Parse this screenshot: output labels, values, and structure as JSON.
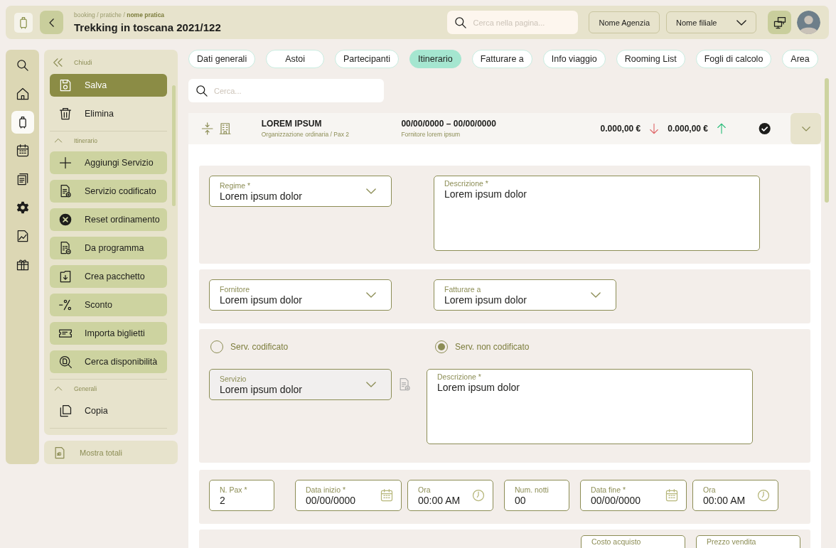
{
  "header": {
    "breadcrumb": "booking / pratiche / **nome pratica**",
    "title": "Trekking in toscana 2021/122",
    "search": {
      "placeholder": "Cerca nella pagina..."
    },
    "agency": "Nome Agenzia",
    "branch": "Nome filiale"
  },
  "rail": [
    {
      "selected": false
    },
    {
      "selected": false
    },
    {
      "selected": true
    },
    {
      "selected": false
    },
    {
      "selected": false
    },
    {
      "selected": false
    },
    {
      "selected": false
    },
    {
      "selected": false
    }
  ],
  "sidebar": {
    "close": "Chiudi",
    "groups": [
      {
        "items": [
          {
            "label": "Salva",
            "kind": "primary"
          },
          {
            "label": "Elimina",
            "kind": "plain"
          }
        ]
      },
      {
        "title": "Itinerario",
        "expanded": true,
        "items": [
          {
            "label": "Aggiungi Servizio",
            "kind": "action"
          },
          {
            "label": "Servizio codificato",
            "kind": "action"
          },
          {
            "label": "Reset ordinamento",
            "kind": "action"
          },
          {
            "label": "Da programma",
            "kind": "action"
          },
          {
            "label": "Crea pacchetto",
            "kind": "action"
          },
          {
            "label": "Sconto",
            "kind": "action"
          },
          {
            "label": "Importa biglietti",
            "kind": "action"
          },
          {
            "label": "Cerca disponibilità",
            "kind": "action"
          }
        ]
      },
      {
        "title": "Generali",
        "expanded": true,
        "items": [
          {
            "label": "Copia",
            "kind": "plain"
          }
        ]
      }
    ],
    "totals": "Mostra totali"
  },
  "tabs": [
    {
      "label": "Dati generali",
      "selected": false
    },
    {
      "label": "Astoi",
      "selected": false
    },
    {
      "label": "Partecipanti",
      "selected": false
    },
    {
      "label": "Itinerario",
      "selected": true
    },
    {
      "label": "Fatturare a",
      "selected": false
    },
    {
      "label": "Info viaggio",
      "selected": false
    },
    {
      "label": "Rooming List",
      "selected": false
    },
    {
      "label": "Fogli  di calcolo",
      "selected": false
    },
    {
      "label": "Area",
      "selected": false
    }
  ],
  "search": {
    "placeholder": "Cerca..."
  },
  "service": {
    "title": "LOREM IPSUM",
    "subtitle": "Organizzazione ordinaria / Pax 2",
    "dates": "00/00/0000 – 00/00/0000",
    "supplier": "Fornitore lorem ipsum",
    "cost": "0.000,00 €",
    "price": "0.000,00 €",
    "confirmed": true,
    "expanded": true
  },
  "sections": [
    {
      "fields": [
        {
          "kind": "select",
          "label": "Regime *",
          "value": "Lorem ipsum dolor"
        },
        {
          "kind": "textarea",
          "label": "Descrizione *",
          "value": "Lorem ipsum dolor"
        }
      ]
    },
    {
      "fields": [
        {
          "kind": "select",
          "label": "Fornitore",
          "value": "Lorem ipsum dolor"
        },
        {
          "kind": "select",
          "label": "Fatturare a",
          "value": "Lorem ipsum dolor"
        }
      ]
    },
    {
      "radios": [
        {
          "label": "Serv. codificato",
          "selected": false
        },
        {
          "label": "Serv. non codificato",
          "selected": true
        }
      ],
      "fields": [
        {
          "kind": "select",
          "label": "Servizio",
          "value": "Lorem ipsum dolor",
          "disabled": true
        },
        {
          "kind": "textarea",
          "label": "Descrizione *",
          "value": "Lorem ipsum dolor"
        }
      ]
    },
    {
      "fields": [
        {
          "kind": "text",
          "label": "N. Pax *",
          "value": "2"
        },
        {
          "kind": "date",
          "label": "Data inizio *",
          "value": "00/00/0000"
        },
        {
          "kind": "time",
          "label": "Ora",
          "value": "00:00 AM"
        },
        {
          "kind": "text",
          "label": "Num. notti",
          "value": "00"
        },
        {
          "kind": "date",
          "label": "Data fine *",
          "value": "00/00/0000"
        },
        {
          "kind": "time",
          "label": "Ora",
          "value": "00:00 AM"
        }
      ]
    },
    {
      "fields": [
        {
          "kind": "price",
          "label": "Costo acquisto"
        },
        {
          "kind": "price",
          "label": "Prezzo vendita"
        }
      ]
    }
  ]
}
